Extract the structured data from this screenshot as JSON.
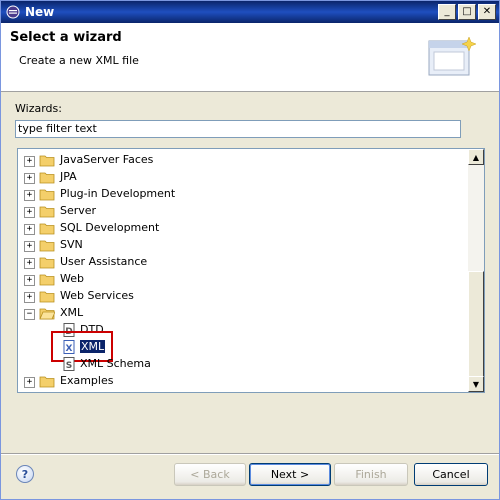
{
  "window": {
    "title": "New",
    "min_glyph": "_",
    "max_glyph": "□",
    "close_glyph": "✕"
  },
  "header": {
    "title": "Select a wizard",
    "description": "Create a new XML file"
  },
  "filter": {
    "label": "Wizards:",
    "value": "type filter text"
  },
  "tree": {
    "items": [
      {
        "label": "JavaServer Faces",
        "expander": "+",
        "icon": "folder-icon"
      },
      {
        "label": "JPA",
        "expander": "+",
        "icon": "folder-icon"
      },
      {
        "label": "Plug-in Development",
        "expander": "+",
        "icon": "folder-icon"
      },
      {
        "label": "Server",
        "expander": "+",
        "icon": "folder-icon"
      },
      {
        "label": "SQL Development",
        "expander": "+",
        "icon": "folder-icon"
      },
      {
        "label": "SVN",
        "expander": "+",
        "icon": "folder-icon"
      },
      {
        "label": "User Assistance",
        "expander": "+",
        "icon": "folder-icon"
      },
      {
        "label": "Web",
        "expander": "+",
        "icon": "folder-icon"
      },
      {
        "label": "Web Services",
        "expander": "+",
        "icon": "folder-icon"
      },
      {
        "label": "XML",
        "expander": "−",
        "icon": "open-folder-icon"
      },
      {
        "label": "DTD",
        "icon": "dtd-file-icon",
        "icon_letter": "D"
      },
      {
        "label": "XML",
        "icon": "xml-file-icon",
        "icon_letter": "X",
        "selected": true
      },
      {
        "label": "XML Schema",
        "icon": "xml-schema-icon",
        "icon_letter": "S"
      },
      {
        "label": "Examples",
        "expander": "+",
        "icon": "folder-icon"
      }
    ]
  },
  "buttons": {
    "back": "< Back",
    "next": "Next >",
    "finish": "Finish",
    "cancel": "Cancel",
    "help": "?"
  },
  "scroll": {
    "up": "▲",
    "down": "▼"
  },
  "colors": {
    "selection": "#0a246a",
    "highlight_box": "#cc0000",
    "title_bar": "#0a246a",
    "folder": "#f4cf6a"
  }
}
